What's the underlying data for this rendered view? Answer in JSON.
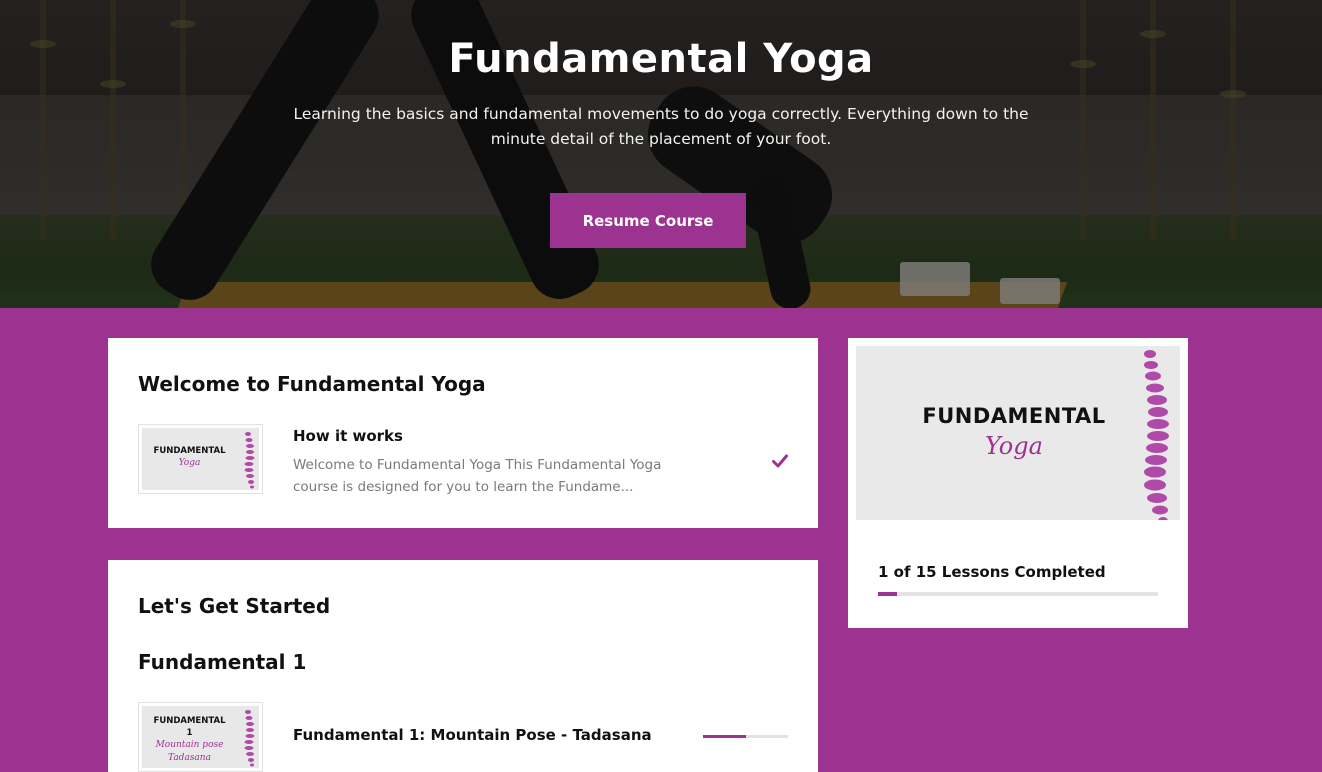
{
  "hero": {
    "title": "Fundamental Yoga",
    "description": "Learning the basics and fundamental movements to do yoga correctly. Everything down to the minute detail of the placement of your foot.",
    "resume_label": "Resume Course"
  },
  "colors": {
    "brand": "#9c3390",
    "card": "#ffffff",
    "track": "#e3e3e3"
  },
  "welcome_section": {
    "title": "Welcome to Fundamental Yoga",
    "lesson": {
      "thumb_line1": "FUNDAMENTAL",
      "thumb_line2": "Yoga",
      "title": "How it works",
      "excerpt": "Welcome to Fundamental Yoga This Fundamental Yoga course is designed for you to learn the Fundame...",
      "status_icon": "check-icon"
    }
  },
  "started_section": {
    "title": "Let's Get Started",
    "topic_title": "Fundamental 1",
    "lesson": {
      "thumb_line1": "FUNDAMENTAL",
      "thumb_line2": "1",
      "thumb_line3": "Mountain pose",
      "thumb_line4": "Tadasana",
      "title": "Fundamental 1: Mountain Pose - Tadasana",
      "progress_fraction": 0.5
    }
  },
  "sidebar": {
    "image_line1": "FUNDAMENTAL",
    "image_line2": "Yoga",
    "progress_label": "1 of 15 Lessons Completed",
    "lessons_completed": 1,
    "lessons_total": 15
  }
}
